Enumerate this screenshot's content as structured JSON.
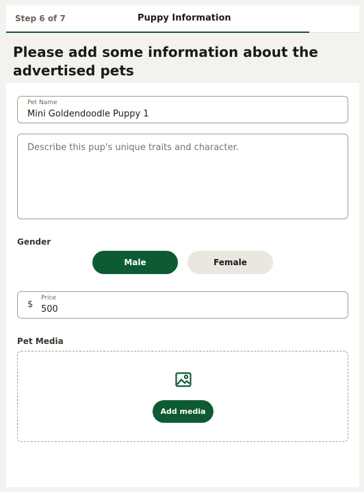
{
  "header": {
    "step": "Step 6 of 7",
    "title": "Puppy Information",
    "progress_fraction": 0.86
  },
  "heading": "Please add some information about the advertised pets",
  "form": {
    "pet_name": {
      "label": "Pet Name",
      "value": "Mini Goldendoodle Puppy 1"
    },
    "description": {
      "placeholder": "Describe this pup's unique traits and character."
    },
    "gender": {
      "label": "Gender",
      "options": [
        "Male",
        "Female"
      ],
      "selected": "Male"
    },
    "price": {
      "currency": "$",
      "label": "Price",
      "value": "500"
    },
    "media": {
      "label": "Pet Media",
      "button": "Add media",
      "icon": "image-icon"
    }
  },
  "colors": {
    "brand_green": "#0e5a33",
    "unselected_pill": "#ebe6e0",
    "border": "#a89d88"
  }
}
